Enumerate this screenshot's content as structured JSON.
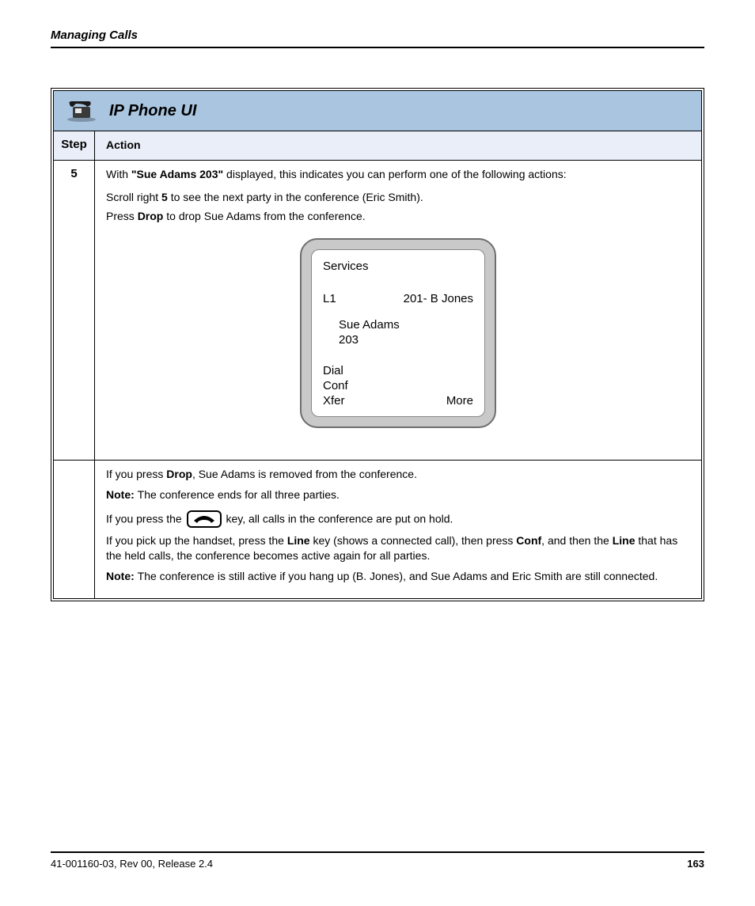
{
  "page": {
    "header_text": "Managing Calls",
    "footer_left": "41-001160-03, Rev 00, Release 2.4",
    "footer_right": "163"
  },
  "table": {
    "title": "IP Phone UI",
    "headers": {
      "step": "Step",
      "action": "Action"
    },
    "step5": {
      "num": "5",
      "intro_pre": "With ",
      "intro_party": "\"Sue Adams 203\"",
      "intro_post": " displayed, this indicates you can perform one of the following actions:",
      "bullet1_pre": "Scroll right ",
      "bullet1_bold": "5",
      "bullet1_post": " to see the next party in the conference (Eric Smith).",
      "bullet2_pre": "Press ",
      "bullet2_bold": "Drop",
      "bullet2_post": " to drop Sue Adams from the conference."
    },
    "lcd": {
      "services": "Services",
      "line": "L1",
      "top_right": "201- B Jones",
      "contact_name": "Sue Adams",
      "contact_ext": "203",
      "sk_dial": "Dial",
      "sk_conf": "Conf",
      "sk_xfer": "Xfer",
      "sk_more": "More"
    },
    "step5b": {
      "part1_pre": "If you press ",
      "part1_bold": "Drop",
      "part1_post": ", Sue Adams is removed from the conference.",
      "part2_note_label": "Note: ",
      "part2_note_body": "The conference ends for all three parties.",
      "part3_pre": "If you press the ",
      "part3_post1": " key, all calls in the conference are put on hold.",
      "part4_pre1": "If you pick up the handset, press the ",
      "part4_bold1": "Line",
      "part4_mid1": " key (shows a connected call), then press ",
      "part4_bold2": "Conf",
      "part4_mid2": ", and then the ",
      "part4_bold3": "Line",
      "part4_post2": " that has the held calls, the conference becomes active again for all parties.",
      "part5_note_label": "Note: ",
      "part5_note_body": "The conference is still active if you hang up (B. Jones), and Sue Adams and Eric Smith are still connected."
    }
  }
}
